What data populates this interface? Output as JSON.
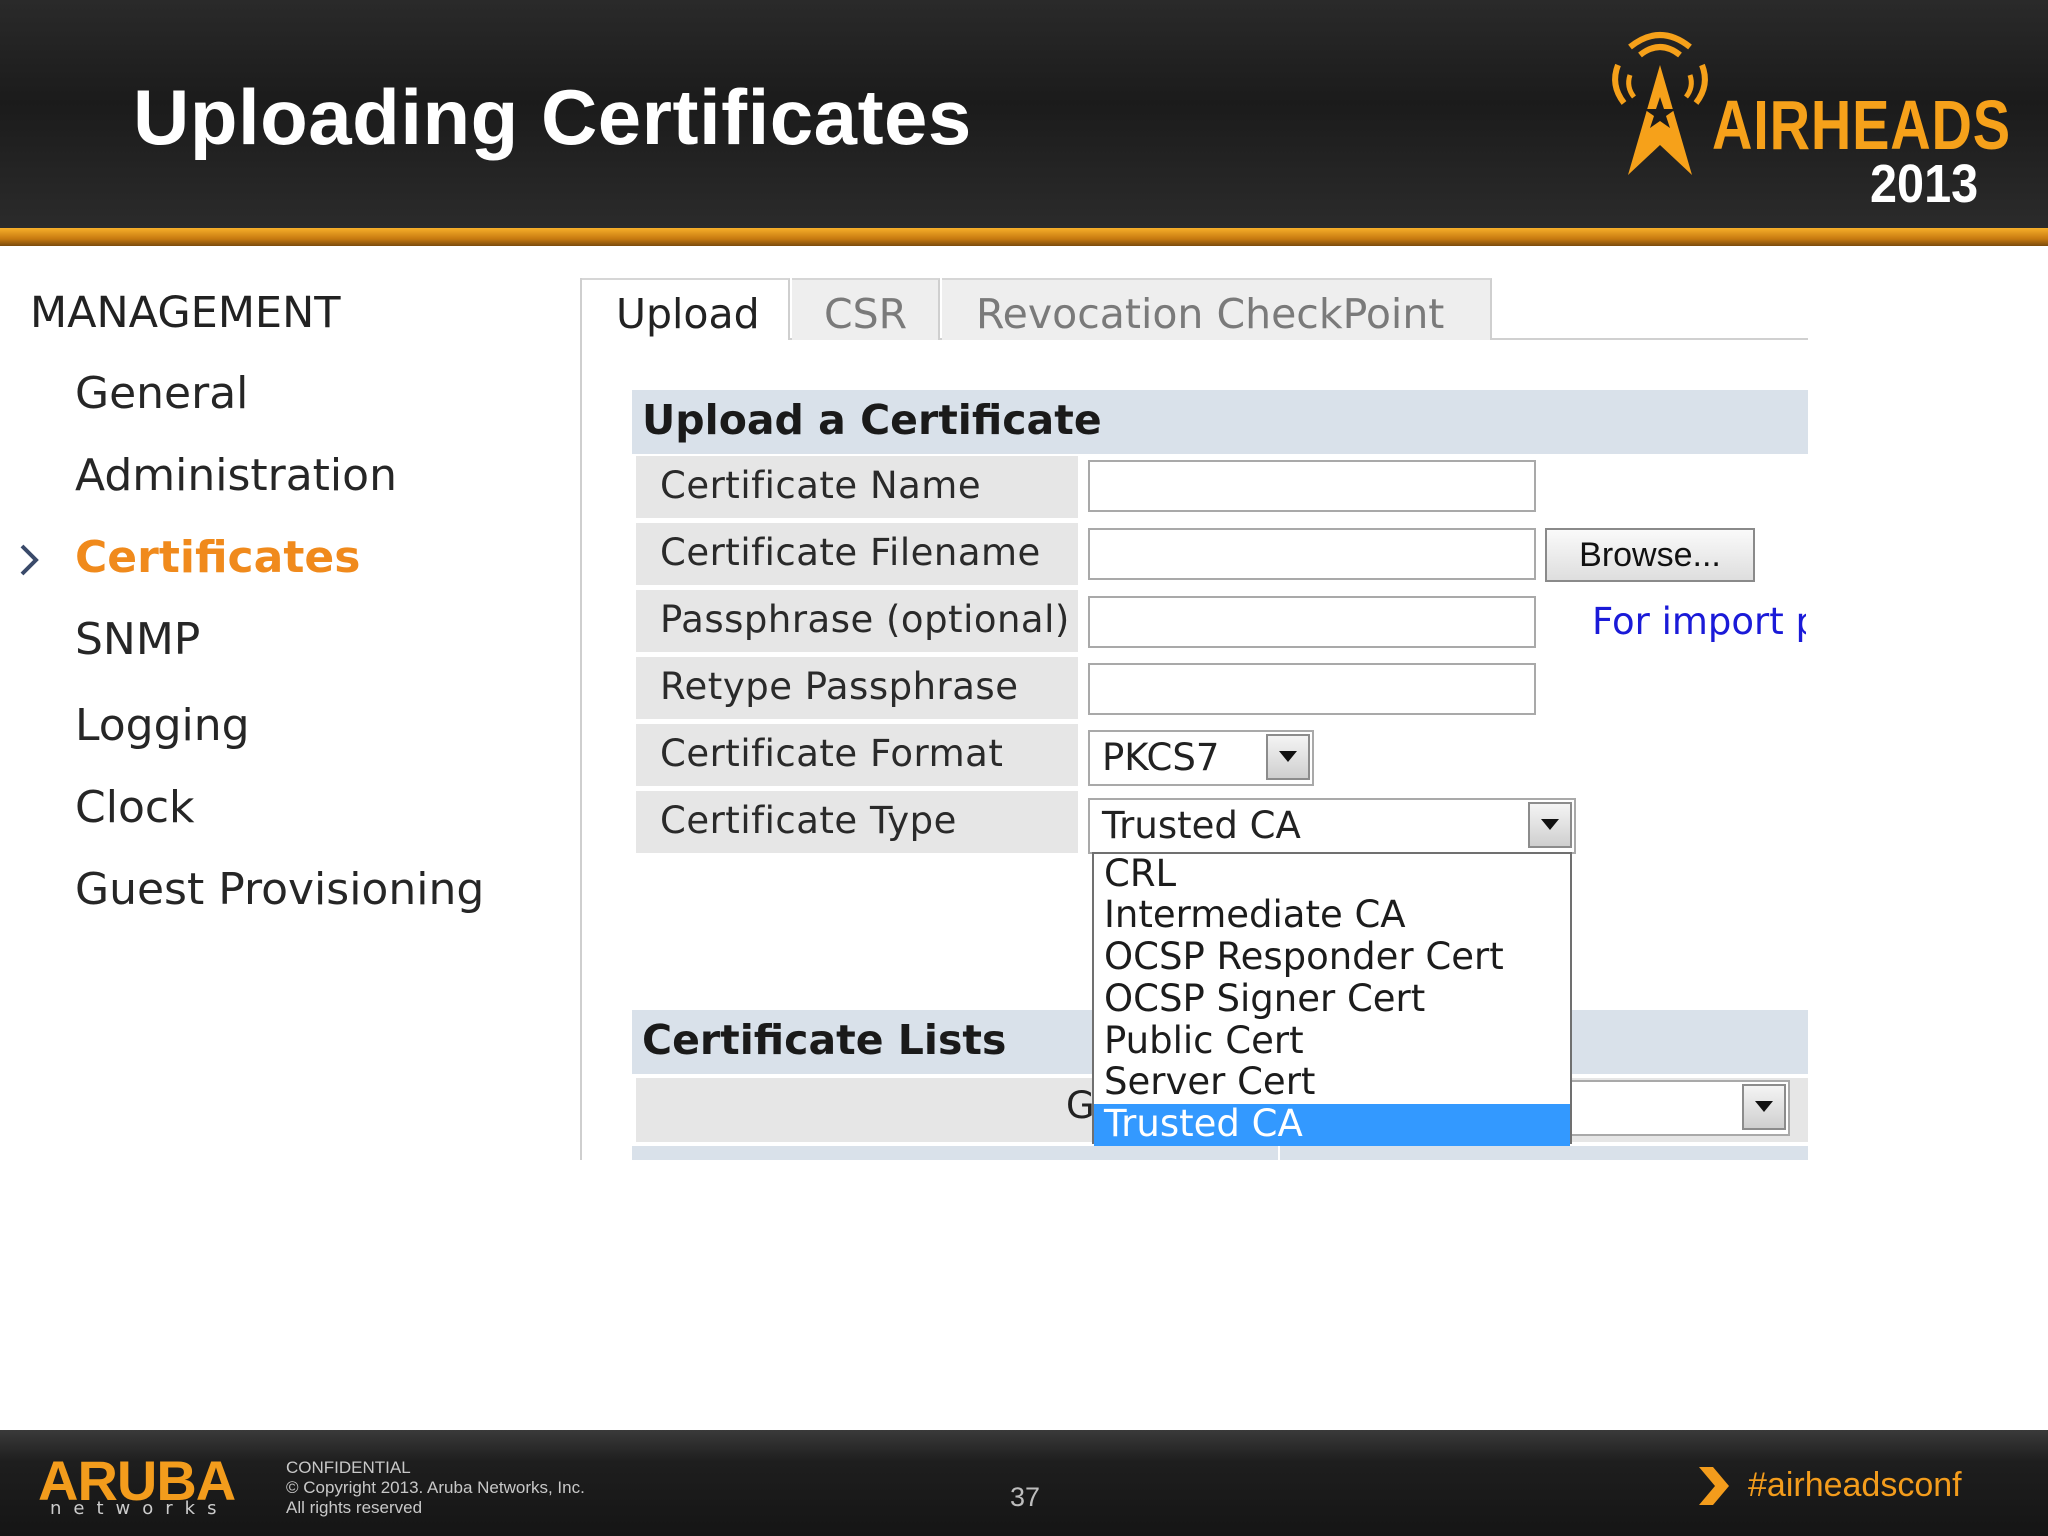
{
  "slide": {
    "title": "Uploading Certificates",
    "brand": {
      "word": "AIRHEADS",
      "year": "2013"
    }
  },
  "sidebar": {
    "heading": "MANAGEMENT",
    "items": [
      {
        "label": "General"
      },
      {
        "label": "Administration"
      },
      {
        "label": "Certificates",
        "active": true
      },
      {
        "label": "SNMP"
      },
      {
        "label": "Logging"
      },
      {
        "label": "Clock"
      },
      {
        "label": "Guest Provisioning"
      }
    ]
  },
  "tabs": [
    {
      "label": "Upload",
      "selected": true
    },
    {
      "label": "CSR"
    },
    {
      "label": "Revocation CheckPoint"
    }
  ],
  "upload_section": {
    "title": "Upload a Certificate",
    "fields": {
      "name": {
        "label": "Certificate Name",
        "value": ""
      },
      "filename": {
        "label": "Certificate Filename",
        "value": ""
      },
      "passphrase": {
        "label": "Passphrase (optional)",
        "value": ""
      },
      "retype": {
        "label": "Retype Passphrase",
        "value": ""
      },
      "format": {
        "label": "Certificate Format",
        "value": "PKCS7"
      },
      "type": {
        "label": "Certificate Type",
        "value": "Trusted CA"
      }
    },
    "browse_label": "Browse...",
    "import_note": "For import p",
    "type_options": [
      "CRL",
      "Intermediate CA",
      "OCSP Responder Cert",
      "OCSP Signer Cert",
      "Public Cert",
      "Server Cert",
      "Trusted CA"
    ],
    "type_selected_option": "Trusted CA"
  },
  "lists_section": {
    "title": "Certificate Lists",
    "row_label_visible": "G"
  },
  "footer": {
    "company": "ARUBA",
    "company_sub": "networks",
    "legal_lines": [
      "CONFIDENTIAL",
      "© Copyright 2013. Aruba Networks, Inc.",
      "All rights reserved"
    ],
    "page_number": "37",
    "hashtag": "#airheadsconf"
  },
  "colors": {
    "accent_orange": "#f08a1c",
    "selection_blue": "#3399ff",
    "section_bar": "#d9e1ea",
    "link_blue": "#1a1ad8"
  }
}
